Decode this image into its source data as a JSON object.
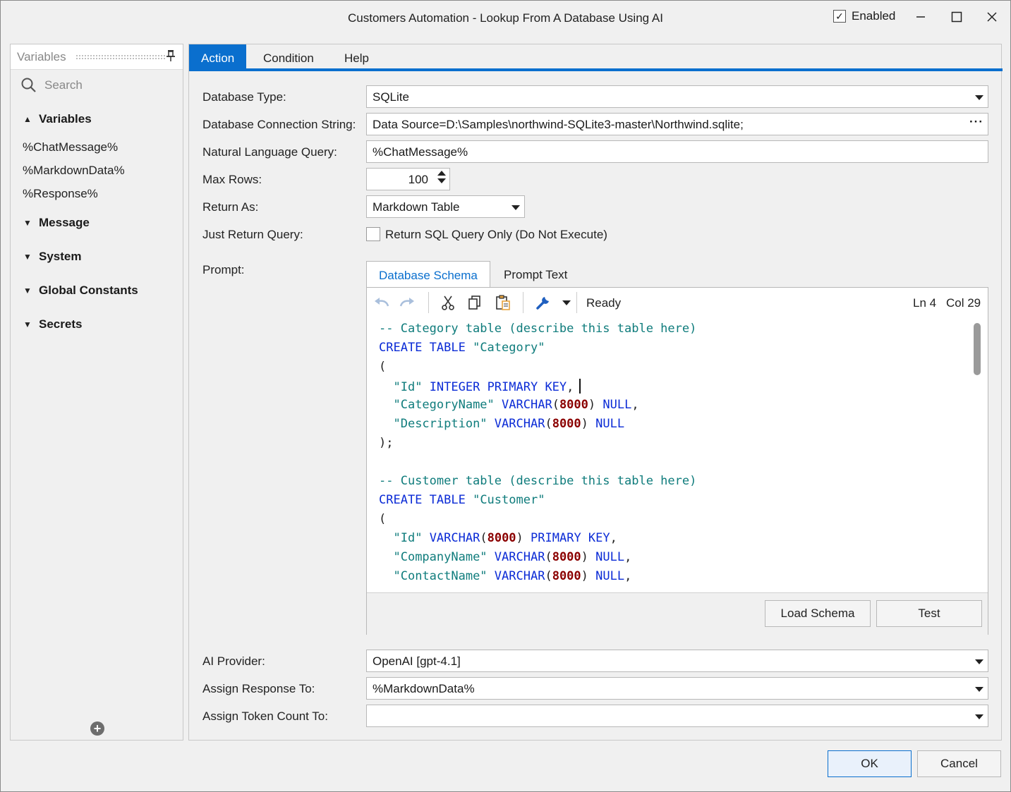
{
  "window": {
    "title": "Customers Automation - Lookup From A Database Using AI",
    "enabled_label": "Enabled",
    "enabled_checked": true
  },
  "left_panel": {
    "title": "Variables",
    "search_placeholder": "Search",
    "groups": [
      {
        "label": "Variables",
        "expanded": true,
        "items": [
          "%ChatMessage%",
          "%MarkdownData%",
          "%Response%"
        ]
      },
      {
        "label": "Message",
        "expanded": false
      },
      {
        "label": "System",
        "expanded": false
      },
      {
        "label": "Global Constants",
        "expanded": false
      },
      {
        "label": "Secrets",
        "expanded": false
      }
    ]
  },
  "tabs": [
    "Action",
    "Condition",
    "Help"
  ],
  "form": {
    "database_type": {
      "label": "Database Type:",
      "value": "SQLite"
    },
    "connection_string": {
      "label": "Database Connection String:",
      "value": "Data Source=D:\\Samples\\northwind-SQLite3-master\\Northwind.sqlite;"
    },
    "nl_query": {
      "label": "Natural Language Query:",
      "value": "%ChatMessage%"
    },
    "max_rows": {
      "label": "Max Rows:",
      "value": "100"
    },
    "return_as": {
      "label": "Return As:",
      "value": "Markdown Table"
    },
    "just_return_query": {
      "label": "Just Return Query:",
      "checkbox_label": "Return SQL Query Only (Do Not Execute)",
      "checked": false
    },
    "prompt": {
      "label": "Prompt:"
    },
    "ai_provider": {
      "label": "AI Provider:",
      "value": "OpenAI [gpt-4.1]"
    },
    "assign_response": {
      "label": "Assign Response To:",
      "value": "%MarkdownData%"
    },
    "assign_token_count": {
      "label": "Assign Token Count To:",
      "value": ""
    }
  },
  "prompt_editor": {
    "tabs": [
      "Database Schema",
      "Prompt Text"
    ],
    "status": "Ready",
    "line": "Ln 4",
    "col": "Col 29",
    "code": {
      "l1": "-- Category table (describe this table here)",
      "l2a": "CREATE TABLE",
      "l2b": "\"Category\"",
      "l3": "(",
      "l4a": "\"Id\"",
      "l4b": "INTEGER PRIMARY KEY",
      "l4c": ",",
      "l5a": "\"CategoryName\"",
      "l5b": "VARCHAR",
      "l5c": "8000",
      "l5d": "NULL",
      "l6a": "\"Description\"",
      "l6b": "VARCHAR",
      "l6c": "8000",
      "l6d": "NULL",
      "l7": ");",
      "l9": "-- Customer table (describe this table here)",
      "l10a": "CREATE TABLE",
      "l10b": "\"Customer\"",
      "l11": "(",
      "l12a": "\"Id\"",
      "l12b": "VARCHAR",
      "l12c": "8000",
      "l12d": "PRIMARY KEY",
      "l13a": "\"CompanyName\"",
      "l13b": "VARCHAR",
      "l13c": "8000",
      "l13d": "NULL",
      "l14a": "\"ContactName\"",
      "l14b": "VARCHAR",
      "l14c": "8000",
      "l14d": "NULL"
    },
    "load_schema_label": "Load Schema",
    "test_label": "Test"
  },
  "footer": {
    "ok_label": "OK",
    "cancel_label": "Cancel"
  }
}
